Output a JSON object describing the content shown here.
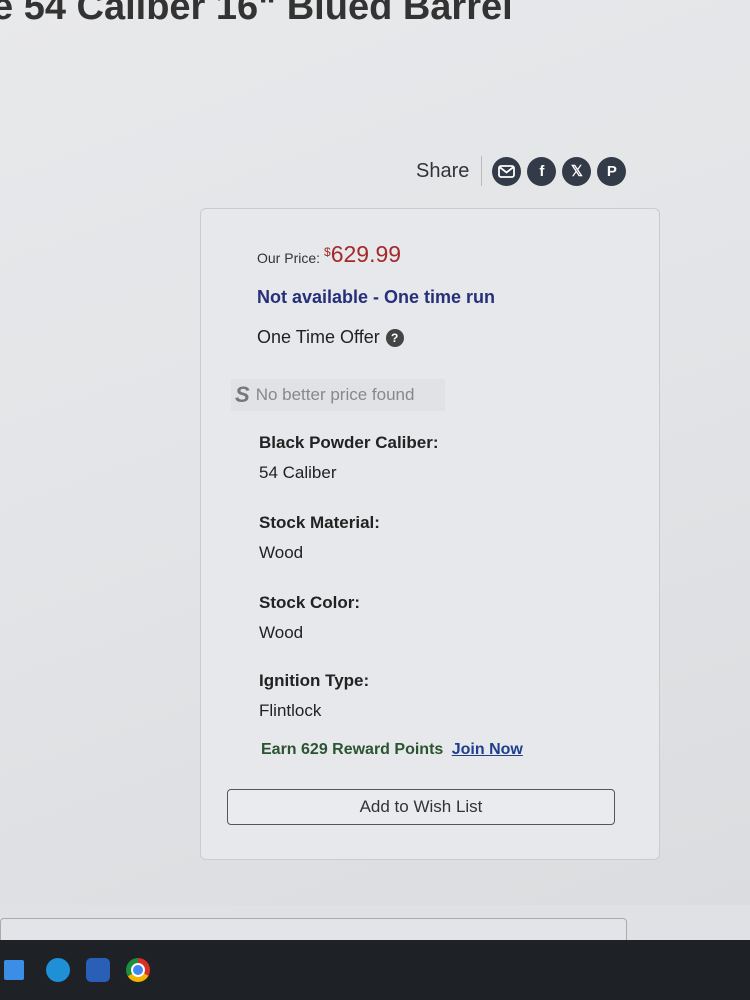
{
  "header": {
    "title": "e 54 Caliber 16\" Blued Barrel"
  },
  "share": {
    "label": "Share",
    "icons": [
      "email-icon",
      "facebook-icon",
      "x-icon",
      "pinterest-icon"
    ]
  },
  "product": {
    "price_label": "Our Price:",
    "currency": "$",
    "price": "629.99",
    "availability": "Not available - One time run",
    "offer": "One Time Offer",
    "better_price": "No better price found",
    "specs": [
      {
        "label": "Black Powder Caliber:",
        "value": "54 Caliber"
      },
      {
        "label": "Stock Material:",
        "value": "Wood"
      },
      {
        "label": "Stock Color:",
        "value": "Wood"
      },
      {
        "label": "Ignition Type:",
        "value": "Flintlock"
      }
    ],
    "reward_text": "Earn 629 Reward Points",
    "join_link": "Join Now",
    "wish_button": "Add to Wish List"
  },
  "colors": {
    "price": "#a32a2a",
    "availability": "#26307a",
    "reward": "#2b5530",
    "share_icon": "#333a48"
  },
  "taskbar": {
    "icons": [
      "windows-icon",
      "edge-icon",
      "outlook-icon",
      "chrome-icon"
    ]
  }
}
